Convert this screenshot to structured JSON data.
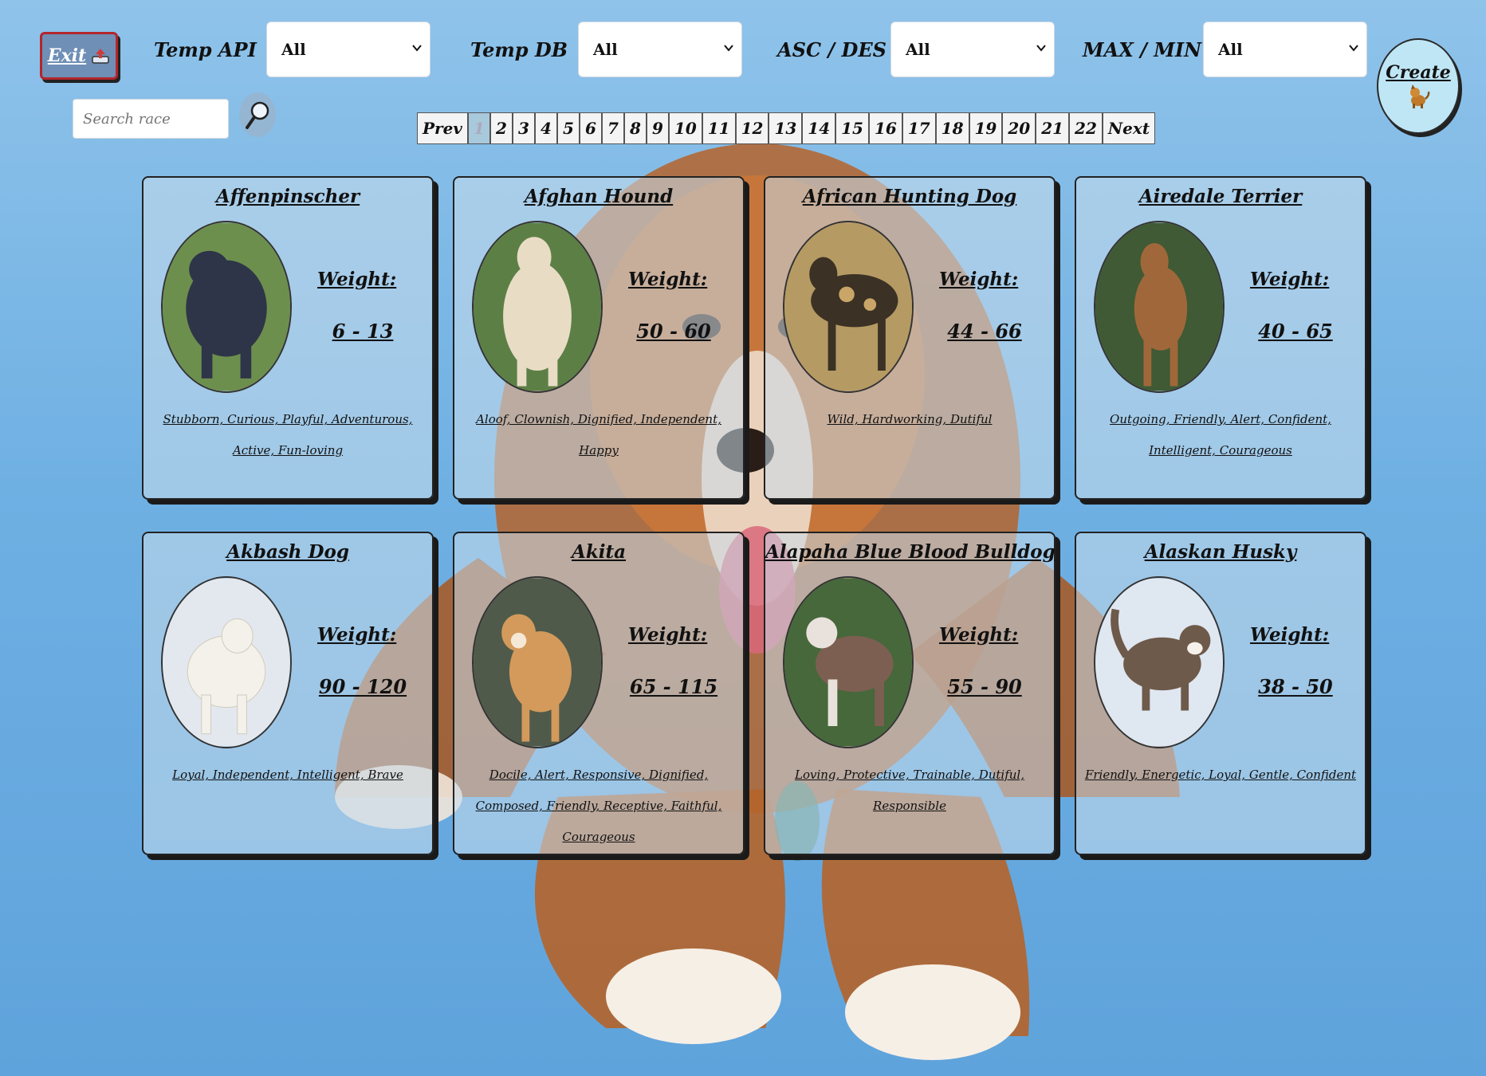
{
  "header": {
    "exit_label": "Exit",
    "filters": [
      {
        "label": "Temp API",
        "value": "All"
      },
      {
        "label": "Temp DB",
        "value": "All"
      },
      {
        "label": "ASC / DES",
        "value": "All"
      },
      {
        "label": "MAX / MIN",
        "value": "All"
      }
    ],
    "create_label": "Create"
  },
  "search": {
    "placeholder": "Search race"
  },
  "pagination": {
    "prev_label": "Prev",
    "next_label": "Next",
    "current_page": "1",
    "pages": [
      "1",
      "2",
      "3",
      "4",
      "5",
      "6",
      "7",
      "8",
      "9",
      "10",
      "11",
      "12",
      "13",
      "14",
      "15",
      "16",
      "17",
      "18",
      "19",
      "20",
      "21",
      "22"
    ]
  },
  "weight_label": "Weight:",
  "breeds": [
    {
      "name": "Affenpinscher",
      "weight": "6 - 13",
      "temperament": "Stubborn, Curious, Playful, Adventurous, Active, Fun-loving",
      "photo_color": "#2e3548",
      "bg_color": "#6d8f4e"
    },
    {
      "name": "Afghan Hound",
      "weight": "50 - 60",
      "temperament": "Aloof, Clownish, Dignified, Independent, Happy",
      "photo_color": "#e9dcc5",
      "bg_color": "#5c7f46"
    },
    {
      "name": "African Hunting Dog",
      "weight": "44 - 66",
      "temperament": "Wild, Hardworking, Dutiful",
      "photo_color": "#3b3124",
      "bg_color": "#b59a63"
    },
    {
      "name": "Airedale Terrier",
      "weight": "40 - 65",
      "temperament": "Outgoing, Friendly, Alert, Confident, Intelligent, Courageous",
      "photo_color": "#a0683a",
      "bg_color": "#3f5a34"
    },
    {
      "name": "Akbash Dog",
      "weight": "90 - 120",
      "temperament": "Loyal, Independent, Intelligent, Brave",
      "photo_color": "#f3f1ea",
      "bg_color": "#e3e8ee"
    },
    {
      "name": "Akita",
      "weight": "65 - 115",
      "temperament": "Docile, Alert, Responsive, Dignified, Composed, Friendly, Receptive, Faithful, Courageous",
      "photo_color": "#d39a5c",
      "bg_color": "#4f5a4a"
    },
    {
      "name": "Alapaha Blue Blood Bulldog",
      "weight": "55 - 90",
      "temperament": "Loving, Protective, Trainable, Dutiful, Responsible",
      "photo_color": "#7d5f52",
      "bg_color": "#46683b"
    },
    {
      "name": "Alaskan Husky",
      "weight": "38 - 50",
      "temperament": "Friendly, Energetic, Loyal, Gentle, Confident",
      "photo_color": "#6e5a4a",
      "bg_color": "#dfe7f1"
    }
  ]
}
